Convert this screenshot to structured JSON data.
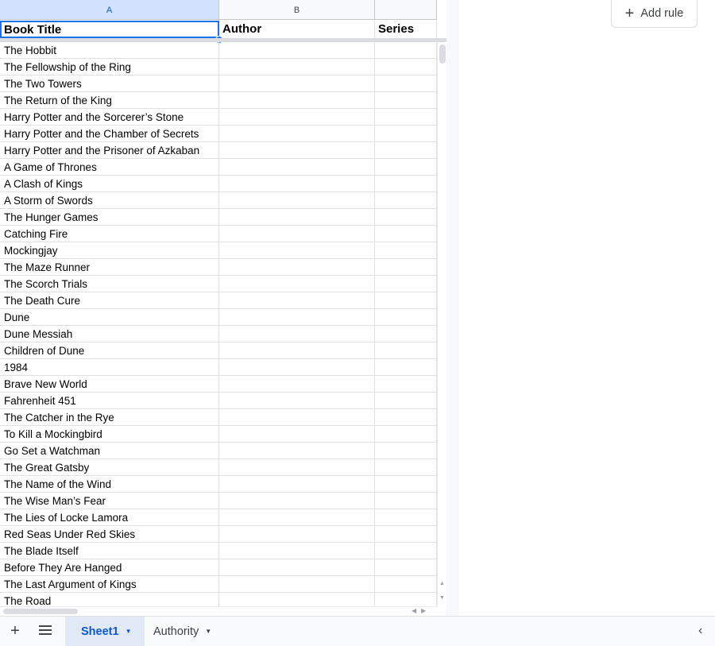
{
  "columns": [
    {
      "letter": "A",
      "header": "Book Title"
    },
    {
      "letter": "B",
      "header": "Author"
    },
    {
      "letter": "C",
      "header": "Series"
    }
  ],
  "books": [
    "The Hobbit",
    "The Fellowship of the Ring",
    "The Two Towers",
    "The Return of the King",
    "Harry Potter and the Sorcerer’s Stone",
    "Harry Potter and the Chamber of Secrets",
    "Harry Potter and the Prisoner of Azkaban",
    "A Game of Thrones",
    "A Clash of Kings",
    "A Storm of Swords",
    "The Hunger Games",
    "Catching Fire",
    "Mockingjay",
    "The Maze Runner",
    "The Scorch Trials",
    "The Death Cure",
    "Dune",
    "Dune Messiah",
    "Children of Dune",
    "1984",
    "Brave New World",
    "Fahrenheit 451",
    "The Catcher in the Rye",
    "To Kill a Mockingbird",
    "Go Set a Watchman",
    "The Great Gatsby",
    "The Name of the Wind",
    "The Wise Man’s Fear",
    "The Lies of Locke Lamora",
    "Red Seas Under Red Skies",
    "The Blade Itself",
    "Before They Are Hanged",
    "The Last Argument of Kings",
    "The Road"
  ],
  "side_panel": {
    "add_rule_label": "Add rule",
    "add_rule_icon": "plus-icon"
  },
  "sheet_tabs": [
    {
      "label": "Sheet1",
      "active": true
    },
    {
      "label": "Authority",
      "active": false
    }
  ],
  "colors": {
    "accent": "#1a73e8",
    "active_tab_bg": "#e1e9f7",
    "active_tab_text": "#0b57d0"
  }
}
